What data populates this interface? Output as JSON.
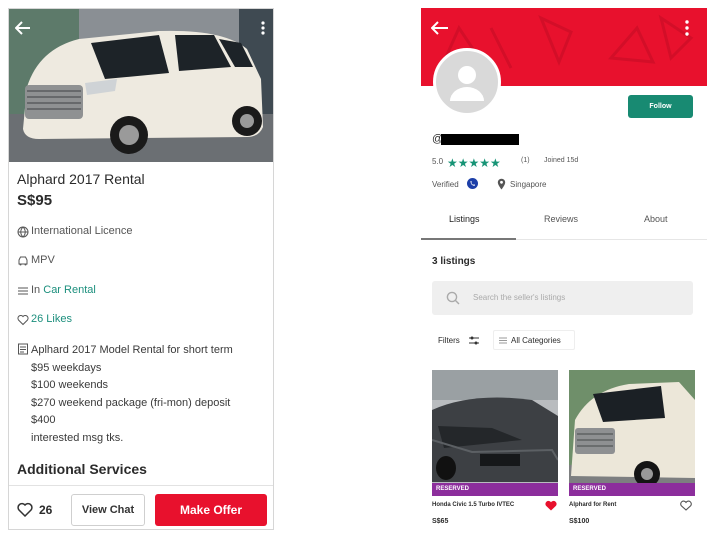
{
  "listing": {
    "title": "Alphard 2017 Rental",
    "price": "S$95",
    "licence": "International Licence",
    "vehicle_type": "MPV",
    "category_prefix": "In",
    "category": "Car Rental",
    "likes": "26 Likes",
    "description_lines": [
      "Aplhard 2017 Model Rental for short term",
      "$95 weekdays",
      "$100 weekends",
      "$270 weekend package (fri-mon)  deposit",
      "$400",
      "interested msg tks."
    ],
    "additional_services": "Additional Services",
    "footer": {
      "like_count": "26",
      "view_chat": "View Chat",
      "make_offer": "Make Offer"
    }
  },
  "profile": {
    "username_prefix": "@",
    "follow": "Follow",
    "rating": "5.0",
    "review_count": "(1)",
    "joined": "Joined 15d",
    "verified": "Verified",
    "location": "Singapore",
    "tabs": [
      "Listings",
      "Reviews",
      "About"
    ],
    "listings_count": "3 listings",
    "search_placeholder": "Search the seller's listings",
    "filters": "Filters",
    "all_categories": "All Categories",
    "cards": [
      {
        "badge": "RESERVED",
        "title": "Honda Civic 1.5 Turbo IVTEC",
        "price": "S$65"
      },
      {
        "badge": "RESERVED",
        "title": "Alphard for Rent",
        "price": "S$100"
      }
    ]
  },
  "colors": {
    "brand_red": "#e8112d",
    "link_green": "#1c8f7d",
    "follow_green": "#188a72",
    "star_green": "#179476",
    "reserved_purple": "#8c2e9c",
    "verified_blue": "#1d3fa8"
  }
}
